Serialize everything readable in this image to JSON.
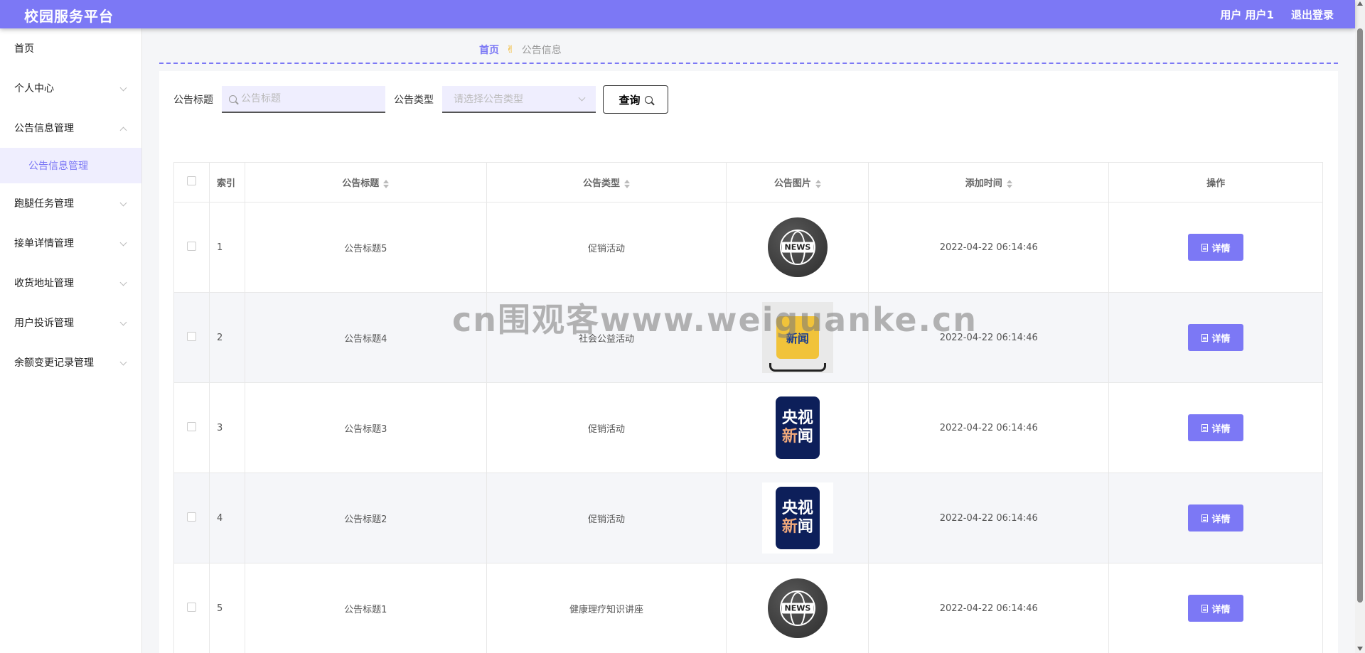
{
  "header": {
    "brand": "校园服务平台",
    "user": "用户 用户1",
    "logout": "退出登录",
    "accent": "#7c78f5"
  },
  "sidebar": {
    "items": [
      {
        "label": "首页"
      },
      {
        "label": "个人中心"
      },
      {
        "label": "公告信息管理"
      },
      {
        "label": "公告信息管理"
      },
      {
        "label": "跑腿任务管理"
      },
      {
        "label": "接单详情管理"
      },
      {
        "label": "收货地址管理"
      },
      {
        "label": "用户投诉管理"
      },
      {
        "label": "余额变更记录管理"
      }
    ]
  },
  "breadcrumb": {
    "home": "首页",
    "current": "公告信息"
  },
  "search": {
    "title_label": "公告标题",
    "title_placeholder": "公告标题",
    "type_label": "公告类型",
    "type_placeholder": "请选择公告类型",
    "query_button": "查询"
  },
  "table": {
    "headers": [
      "索引",
      "公告标题",
      "公告类型",
      "公告图片",
      "添加时间",
      "操作"
    ],
    "rows": [
      {
        "index": "1",
        "title": "公告标题5",
        "type": "促销活动",
        "image": "news-globe",
        "time": "2022-04-22 06:14:46",
        "action": "详情"
      },
      {
        "index": "2",
        "title": "公告标题4",
        "type": "社会公益活动",
        "image": "phone-news",
        "time": "2022-04-22 06:14:46",
        "action": "详情"
      },
      {
        "index": "3",
        "title": "公告标题3",
        "type": "促销活动",
        "image": "cctv-news",
        "time": "2022-04-22 06:14:46",
        "action": "详情"
      },
      {
        "index": "4",
        "title": "公告标题2",
        "type": "促销活动",
        "image": "cctv-news",
        "time": "2022-04-22 06:14:46",
        "action": "详情"
      },
      {
        "index": "5",
        "title": "公告标题1",
        "type": "健康理疗知识讲座",
        "image": "news-globe",
        "time": "2022-04-22 06:14:46",
        "action": "详情"
      }
    ]
  },
  "thumbs": {
    "news_label": "NEWS",
    "cctv_line1": "央视",
    "cctv_line2a": "新",
    "cctv_line2b": "闻",
    "phone_label": "新闻"
  },
  "watermark": "cn围观客www.weiguanke.cn"
}
